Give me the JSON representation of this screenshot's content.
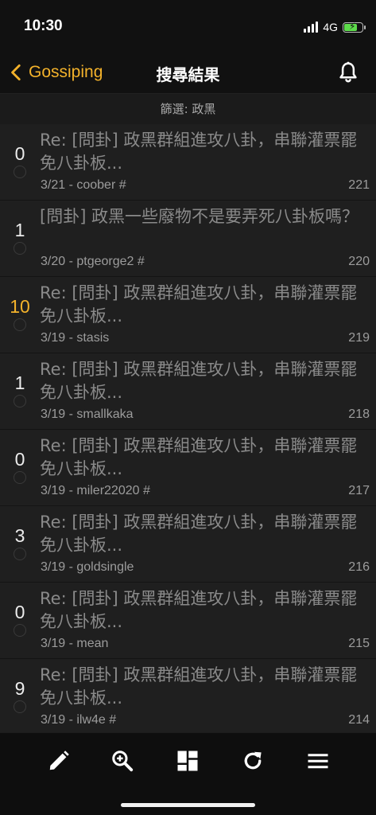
{
  "status": {
    "time": "10:30",
    "network": "4G"
  },
  "nav": {
    "back_label": "Gossiping",
    "title": "搜尋結果"
  },
  "filter": {
    "text": "篩選: 政黑"
  },
  "colors": {
    "accent": "#f3b22b",
    "background": "#111111",
    "row_background": "#1f1f1f",
    "title_text": "#8a8a8a"
  },
  "posts": [
    {
      "count": "0",
      "title": "Re: [問卦] 政黑群組進攻八卦，串聯灌票罷免八卦板...",
      "meta": "3/21 - coober #",
      "num": "221"
    },
    {
      "count": "1",
      "title": "[問卦] 政黑一些廢物不是要弄死八卦板嗎？",
      "meta": "3/20 - ptgeorge2 #",
      "num": "220"
    },
    {
      "count": "10",
      "title": "Re: [問卦] 政黑群組進攻八卦，串聯灌票罷免八卦板...",
      "meta": "3/19 - stasis",
      "num": "219"
    },
    {
      "count": "1",
      "title": "Re: [問卦] 政黑群組進攻八卦，串聯灌票罷免八卦板...",
      "meta": "3/19 - smallkaka",
      "num": "218"
    },
    {
      "count": "0",
      "title": "Re: [問卦] 政黑群組進攻八卦，串聯灌票罷免八卦板...",
      "meta": "3/19 - miler22020 #",
      "num": "217"
    },
    {
      "count": "3",
      "title": "Re: [問卦] 政黑群組進攻八卦，串聯灌票罷免八卦板...",
      "meta": "3/19 - goldsingle",
      "num": "216"
    },
    {
      "count": "0",
      "title": "Re: [問卦] 政黑群組進攻八卦，串聯灌票罷免八卦板...",
      "meta": "3/19 - mean",
      "num": "215"
    },
    {
      "count": "9",
      "title": "Re: [問卦] 政黑群組進攻八卦，串聯灌票罷免八卦板...",
      "meta": "3/19 - ilw4e #",
      "num": "214"
    }
  ],
  "toolbar": {
    "icons": [
      "pencil-icon",
      "search-icon",
      "dashboard-icon",
      "refresh-icon",
      "menu-icon"
    ]
  }
}
